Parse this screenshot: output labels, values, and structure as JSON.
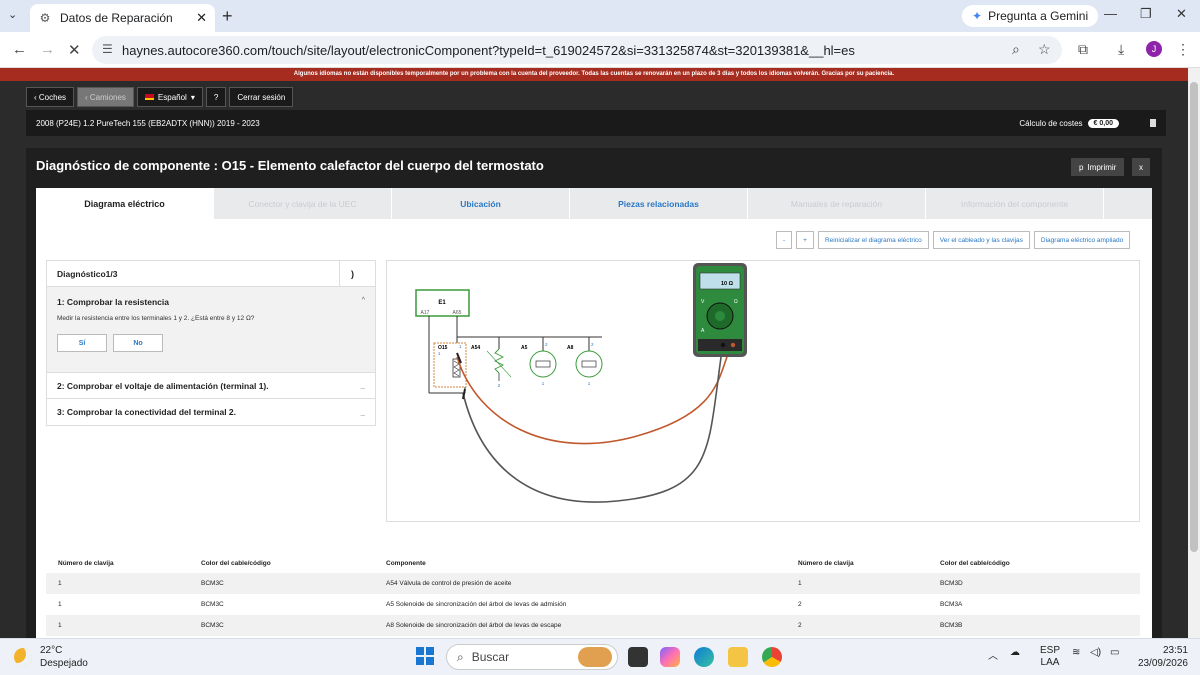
{
  "browser": {
    "tab_title": "Datos de Reparación",
    "new_tab": "+",
    "gemini_label": "Pregunta a Gemini",
    "url": "haynes.autocore360.com/touch/site/layout/electronicComponent?typeId=t_619024572&si=331325874&st=320139381&__hl=es",
    "avatar_letter": "J"
  },
  "banner": "Algunos idiomas no están disponibles temporalmente por un problema con la cuenta del proveedor. Todas las cuentas se renovarán en un plazo de 3 días y todos los idiomas volverán. Gracias por su paciencia.",
  "topbar": {
    "coches": "‹ Coches",
    "camiones": "‹ Camiones",
    "idioma": "Español",
    "ayuda": "?",
    "cerrar_sesion": "Cerrar sesión"
  },
  "vehicle": {
    "name": "2008 (P24E) 1.2 PureTech 155 (EB2ADTX (HNN)) 2019 - 2023",
    "cost_label": "Cálculo de costes",
    "cost_value": "€  0,00"
  },
  "panel": {
    "title": "Diagnóstico de componente : O15 - Elemento calefactor del cuerpo del termostato",
    "print_label": "Imprimir",
    "print_icon": "p",
    "close_label": "x"
  },
  "tabs": [
    {
      "label": "Diagrama eléctrico"
    },
    {
      "label": "Conector y clavija de la UEC"
    },
    {
      "label": "Ubicación"
    },
    {
      "label": "Piezas relacionadas"
    },
    {
      "label": "Manuales de reparación"
    },
    {
      "label": "Información del componente"
    }
  ],
  "diagram_buttons": {
    "minus": "-",
    "plus": "+",
    "reset": "Reinicializar el diagrama eléctrico",
    "wiring": "Ver el cableado y las clavijas",
    "expanded": "Diagrama eléctrico ampliado"
  },
  "diagnostic": {
    "header": "Diagnóstico1/3",
    "next": ")",
    "step1_title": "1: Comprobar la resistencia",
    "step1_desc": "Medir la resistencia entre los terminales 1 y 2. ¿Está entre 8 y 12 Ω?",
    "yes": "Sí",
    "no": "No",
    "step2_title": "2: Comprobar el voltaje de alimentación (terminal 1).",
    "step3_title": "3: Comprobar la conectividad del terminal 2.",
    "collapsed_marker": "_",
    "expanded_marker": "^"
  },
  "schematic": {
    "ecu": "E1",
    "ecu_pin_a": "A17",
    "ecu_pin_b": "A65",
    "comp_o15": "O15",
    "comp_a54": "A54",
    "comp_a5": "A5",
    "comp_a8": "A8",
    "pin1": "1",
    "pin2": "2",
    "meter_display": "10 Ω",
    "meter_v": "V",
    "meter_a": "A",
    "meter_ohm": "Ω"
  },
  "table": {
    "headers": [
      "Número de clavija",
      "Color del cable/código",
      "Componente",
      "Número de clavija",
      "Color del cable/código"
    ],
    "rows": [
      [
        "1",
        "BCM3C",
        "A54 Válvula de control de presión de aceite",
        "1",
        "BCM3D"
      ],
      [
        "1",
        "BCM3C",
        "A5 Solenoide de sincronización del árbol de levas de admisión",
        "2",
        "BCM3A"
      ],
      [
        "1",
        "BCM3C",
        "A8 Solenoide de sincronización del árbol de levas de escape",
        "2",
        "BCM3B"
      ]
    ]
  },
  "taskbar": {
    "temp": "22°C",
    "weather": "Despejado",
    "search": "Buscar",
    "lang1": "ESP",
    "lang2": "LAA",
    "time": "23:51",
    "date": "23/09/2026"
  },
  "colors": {
    "banner": "#a62c1f",
    "link": "#2a78c6",
    "ecu_green": "#3a9a3a",
    "wire_red": "#c0582c",
    "wire_black": "#555555",
    "meter_green": "#2e8b3d"
  }
}
